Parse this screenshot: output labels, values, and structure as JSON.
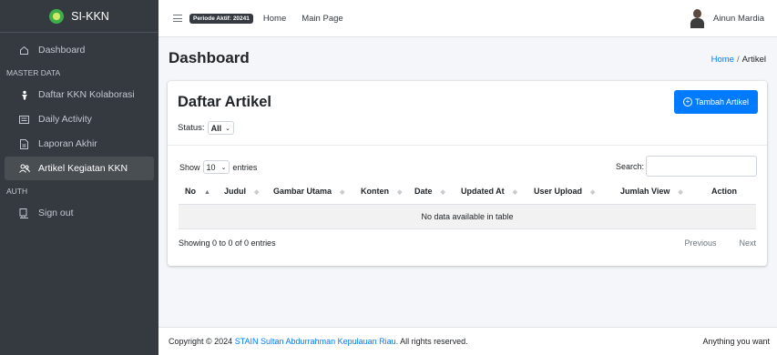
{
  "brand": {
    "name": "SI-KKN"
  },
  "sidebar": {
    "items": [
      {
        "label": "Dashboard",
        "icon": "home-icon"
      },
      {
        "label": "Daftar KKN Kolaborasi",
        "icon": "person-icon"
      },
      {
        "label": "Daily Activity",
        "icon": "activity-list-icon"
      },
      {
        "label": "Laporan Akhir",
        "icon": "document-icon"
      },
      {
        "label": "Artikel Kegiatan KKN",
        "icon": "people-icon",
        "active": true
      },
      {
        "label": "Sign out",
        "icon": "sign-out-icon"
      }
    ],
    "headers": {
      "master": "MASTER DATA",
      "auth": "AUTH"
    }
  },
  "topbar": {
    "period_badge": "Periode Aktif: 20241",
    "links": [
      "Home",
      "Main Page"
    ],
    "user_name": "Ainun Mardia"
  },
  "header": {
    "title": "Dashboard",
    "breadcrumb": {
      "home": "Home",
      "separator": "/",
      "current": "Artikel"
    }
  },
  "card": {
    "title": "Daftar Artikel",
    "status_label": "Status:",
    "status_value": "All",
    "add_button": "Tambah Artikel"
  },
  "table": {
    "show_label": "Show",
    "entries_value": "10",
    "entries_label": "entries",
    "search_label": "Search:",
    "columns": [
      "No",
      "Judul",
      "Gambar Utama",
      "Konten",
      "Date",
      "Updated At",
      "User Upload",
      "Jumlah View",
      "Action"
    ],
    "empty_message": "No data available in table",
    "info": "Showing 0 to 0 of 0 entries",
    "pagination": {
      "previous": "Previous",
      "next": "Next"
    }
  },
  "footer": {
    "copyright_prefix": "Copyright © 2024",
    "organization": "STAIN Sultan Abdurrahman Kepulauan Riau.",
    "rights": "All rights reserved.",
    "right_text": "Anything you want"
  },
  "colors": {
    "sidebar_bg": "#343a40",
    "primary": "#007bff",
    "active_nav": "#494e53",
    "page_bg": "#f4f6f9"
  }
}
